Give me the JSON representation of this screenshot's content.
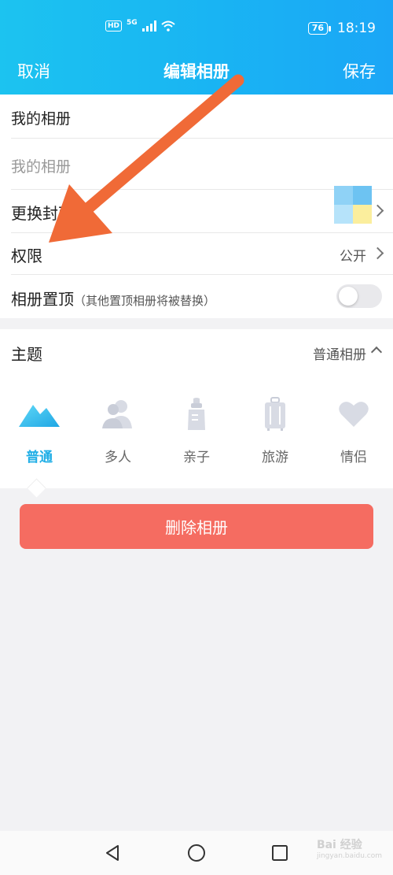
{
  "status_bar": {
    "hd": "HD",
    "network": "5G",
    "battery": "76",
    "time": "18:19"
  },
  "topbar": {
    "cancel": "取消",
    "title": "编辑相册",
    "save": "保存"
  },
  "album": {
    "name": "我的相册",
    "name_placeholder": "我的相册",
    "change_cover": "更换封面",
    "permission": "权限",
    "permission_value": "公开",
    "pin_label": "相册置顶",
    "pin_note": "（其他置顶相册将被替换）",
    "pin_on": false
  },
  "theme": {
    "label": "主题",
    "selected": "普通相册",
    "items": [
      {
        "label": "普通",
        "icon": "mountain-icon"
      },
      {
        "label": "多人",
        "icon": "people-icon"
      },
      {
        "label": "亲子",
        "icon": "baby-bottle-icon"
      },
      {
        "label": "旅游",
        "icon": "suitcase-icon"
      },
      {
        "label": "情侣",
        "icon": "heart-icon"
      }
    ]
  },
  "delete_button": "删除相册",
  "watermark": {
    "text": "Bai 经验",
    "sub": "jingyan.baidu.com"
  },
  "colors": {
    "header": "#1ab4f3",
    "accent": "#20aee6",
    "delete": "#f56c61",
    "arrow": "#f06a37"
  }
}
